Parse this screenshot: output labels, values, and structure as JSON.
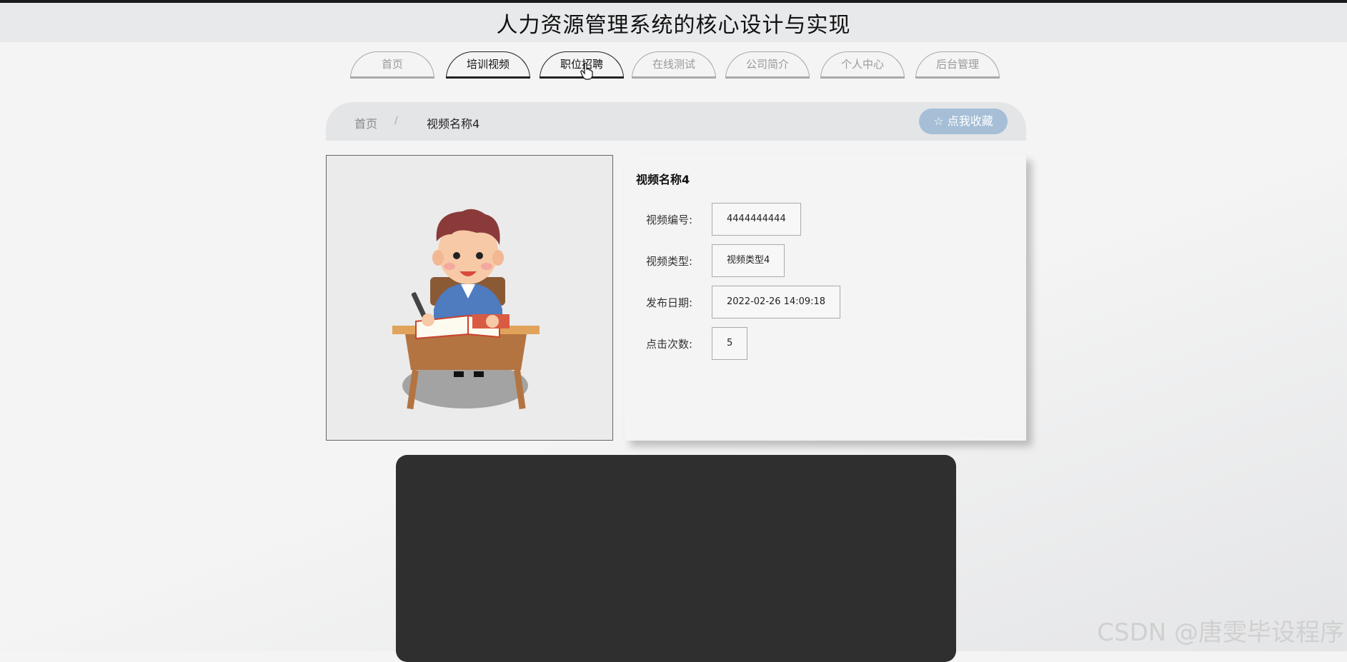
{
  "header": {
    "title": "人力资源管理系统的核心设计与实现"
  },
  "nav": {
    "tabs": [
      {
        "label": "首页",
        "active": false
      },
      {
        "label": "培训视频",
        "active": true
      },
      {
        "label": "职位招聘",
        "active": true
      },
      {
        "label": "在线测试",
        "active": false
      },
      {
        "label": "公司简介",
        "active": false
      },
      {
        "label": "个人中心",
        "active": false
      },
      {
        "label": "后台管理",
        "active": false
      }
    ]
  },
  "breadcrumb": {
    "home": "首页",
    "separator": "/",
    "current": "视频名称4"
  },
  "favorite_button": {
    "label": "☆ 点我收藏",
    "color": "#a6bfd7"
  },
  "detail": {
    "title": "视频名称4",
    "fields": [
      {
        "label": "视频编号:",
        "value": "4444444444"
      },
      {
        "label": "视频类型:",
        "value": "视频类型4"
      },
      {
        "label": "发布日期:",
        "value": "2022-02-26 14:09:18"
      },
      {
        "label": "点击次数:",
        "value": "5"
      }
    ]
  },
  "video": {
    "background": "#2f2f2f"
  },
  "watermark": "CSDN @唐雯毕设程序"
}
